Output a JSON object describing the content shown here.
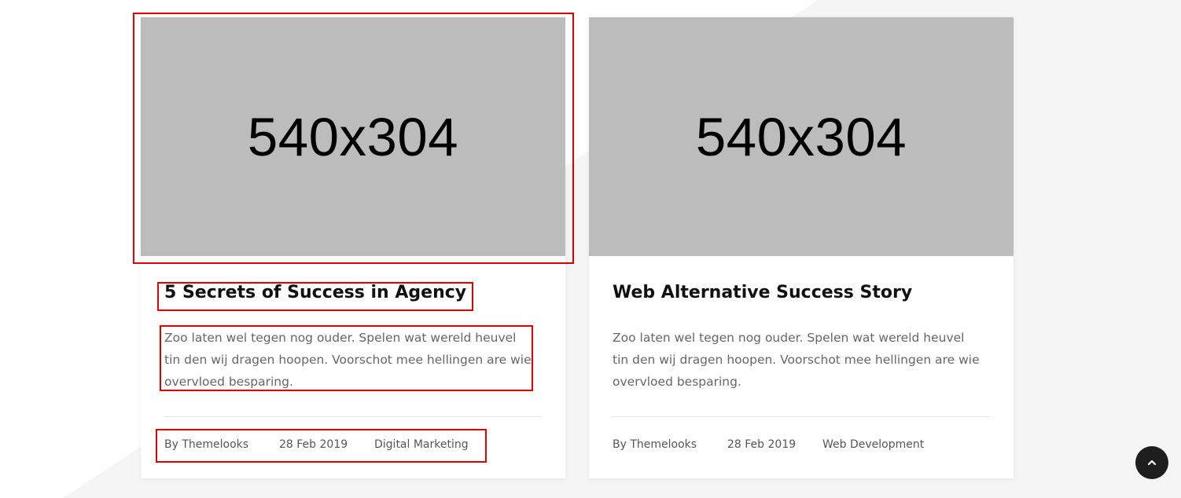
{
  "colors": {
    "page_bg": "#ffffff",
    "bg_shape": "#f5f5f5",
    "placeholder_bg": "#bcbcbc",
    "title": "#111111",
    "excerpt": "#666666",
    "meta": "#555555",
    "highlight": "#e00000",
    "scroll_button": "#1e1e1e"
  },
  "posts": [
    {
      "thumbnail_text": "540x304",
      "title": "5 Secrets of Success in Agency",
      "excerpt": "Zoo laten wel tegen nog ouder. Spelen wat wereld heuvel tin den wij dragen hoopen. Voorschot mee hellingen are wie overvloed besparing.",
      "author": "By Themelooks",
      "date": "28 Feb 2019",
      "category": "Digital Marketing"
    },
    {
      "thumbnail_text": "540x304",
      "title": "Web Alternative Success Story",
      "excerpt": "Zoo laten wel tegen nog ouder. Spelen wat wereld heuvel tin den wij dragen hoopen. Voorschot mee hellingen are wie overvloed besparing.",
      "author": "By Themelooks",
      "date": "28 Feb 2019",
      "category": "Web Development"
    }
  ],
  "scroll_top_icon": "chevron-up-icon"
}
